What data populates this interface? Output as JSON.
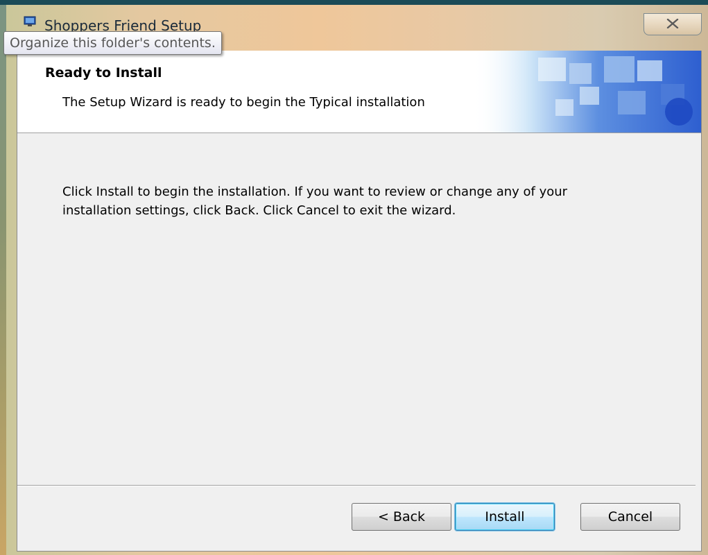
{
  "window": {
    "title": "Shoppers Friend Setup"
  },
  "tooltip": {
    "text": "Organize this folder's contents."
  },
  "banner": {
    "title": "Ready to Install",
    "subtitle": "The Setup Wizard is ready to begin the Typical installation"
  },
  "body": {
    "line1": "Click Install to begin the installation.  If you want to review or change any of your",
    "line2": "installation settings, click Back.  Click Cancel to exit the wizard."
  },
  "buttons": {
    "back": "< Back",
    "install": "Install",
    "cancel": "Cancel"
  },
  "icons": {
    "app": "installer-icon",
    "close": "close-icon"
  },
  "colors": {
    "dialog_background": "#f0f0f0",
    "banner_background": "#ffffff",
    "default_button_border": "#3c7fb1"
  }
}
